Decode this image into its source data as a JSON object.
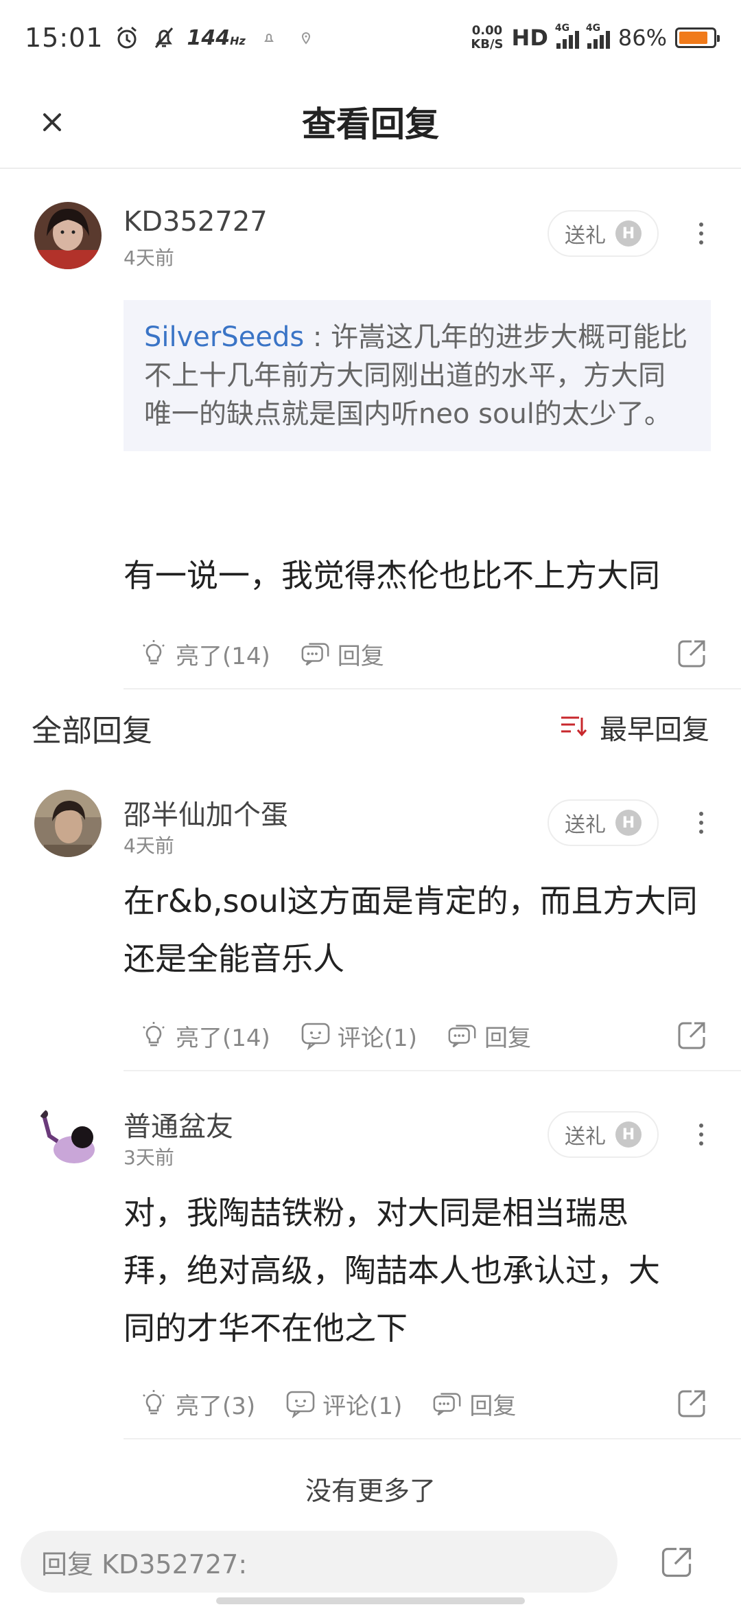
{
  "status_bar": {
    "time": "15:01",
    "refresh_rate": "144",
    "refresh_unit": "Hz",
    "speed_value": "0.00",
    "speed_unit": "KB/S",
    "hd_label": "HD",
    "network1": "4G",
    "network2": "4G",
    "battery_percent": "86%",
    "battery_level": 0.86,
    "battery_color": "#f07a1a"
  },
  "header": {
    "title": "查看回复",
    "close_icon": "close-icon"
  },
  "main_post": {
    "username": "KD352727",
    "time": "4天前",
    "gift_label": "送礼",
    "badge": "H",
    "quote_name": "SilverSeeds",
    "quote_separator": " : ",
    "quote_text": "许嵩这几年的进步大概可能比不上十几年前方大同刚出道的水平，方大同唯一的缺点就是国内听neo soul的太少了。",
    "content": "有一说一，我觉得杰伦也比不上方大同",
    "like_label": "亮了(14)",
    "reply_label": "回复"
  },
  "section": {
    "title": "全部回复",
    "sort_label": "最早回复",
    "accent_color": "#c8282d"
  },
  "replies": [
    {
      "username": "邵半仙加个蛋",
      "time": "4天前",
      "gift_label": "送礼",
      "badge": "H",
      "content_line1": "在r&b,soul这方面是肯定的，而且方大同",
      "content_line2": "还是全能音乐人",
      "like_label": "亮了(14)",
      "comment_label": "评论(1)",
      "reply_label": "回复"
    },
    {
      "username": "普通盆友",
      "time": "3天前",
      "gift_label": "送礼",
      "badge": "H",
      "content_line1": "对，我陶喆铁粉，对大同是相当瑞思",
      "content_line2": "拜，绝对高级，陶喆本人也承认过，大",
      "content_line3": "同的才华不在他之下",
      "like_label": "亮了(3)",
      "comment_label": "评论(1)",
      "reply_label": "回复"
    }
  ],
  "footer": {
    "no_more": "没有更多了",
    "reply_placeholder": "回复 KD352727:"
  }
}
